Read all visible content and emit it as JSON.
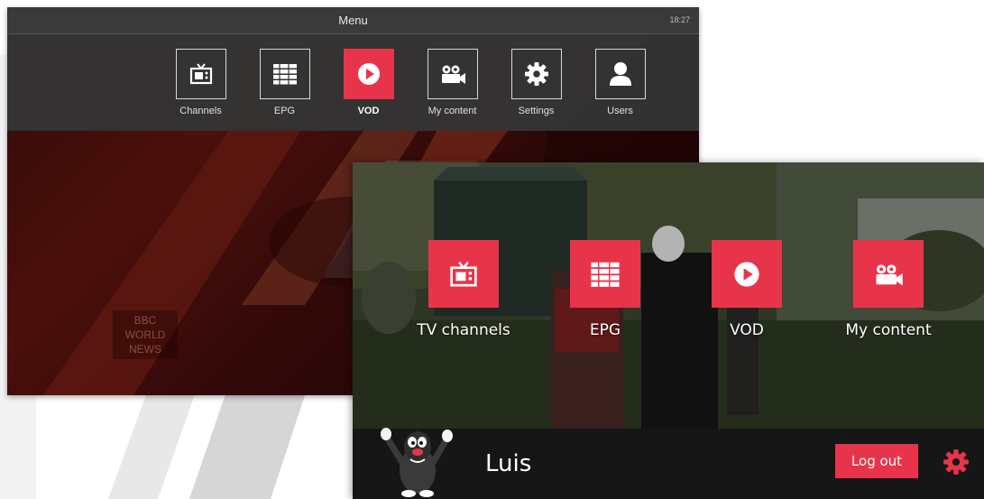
{
  "menu_screen": {
    "title": "Menu",
    "clock": "18:27",
    "items": [
      {
        "label": "Channels",
        "icon": "tv-icon",
        "active": false
      },
      {
        "label": "EPG",
        "icon": "epg-list-icon",
        "active": false
      },
      {
        "label": "VOD",
        "icon": "play-icon",
        "active": true
      },
      {
        "label": "My content",
        "icon": "camera-icon",
        "active": false
      },
      {
        "label": "Settings",
        "icon": "gear-icon",
        "active": false
      },
      {
        "label": "Users",
        "icon": "user-icon",
        "active": false
      }
    ],
    "background_logo": [
      "BBC",
      "WORLD",
      "NEWS"
    ]
  },
  "home_screen": {
    "tiles": [
      {
        "label": "TV channels",
        "icon": "tv-icon"
      },
      {
        "label": "EPG",
        "icon": "epg-list-icon"
      },
      {
        "label": "VOD",
        "icon": "play-icon"
      },
      {
        "label": "My content",
        "icon": "camera-icon"
      }
    ],
    "user_name": "Luis",
    "logout_label": "Log out",
    "settings_icon": "gear-icon"
  },
  "colors": {
    "accent": "#e8344a",
    "menu_bar": "#343434",
    "bottom_bar": "#161616"
  }
}
